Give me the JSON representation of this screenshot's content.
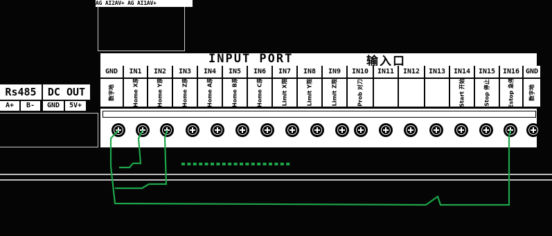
{
  "top_label": "AG AI2AV+ AG AI1AV+",
  "title": {
    "en": "INPUT PORT",
    "cn": "输入口"
  },
  "rs485": {
    "title": "Rs485",
    "a": "A+",
    "b": "B-"
  },
  "dc_out": {
    "title": "DC OUT",
    "gnd": "GND",
    "v5": "5V+"
  },
  "ports": [
    {
      "id": "GND",
      "label": "数字地"
    },
    {
      "id": "IN1",
      "label": "X Home X原点"
    },
    {
      "id": "IN2",
      "label": "Y Home Y原点"
    },
    {
      "id": "IN3",
      "label": "Z Home Z原点"
    },
    {
      "id": "IN4",
      "label": "X Home A原点"
    },
    {
      "id": "IN5",
      "label": "B Home B原点"
    },
    {
      "id": "IN6",
      "label": "C Home C原点"
    },
    {
      "id": "IN7",
      "label": "X Limit X限位"
    },
    {
      "id": "IN8",
      "label": "Y Limit Y限位"
    },
    {
      "id": "IN9",
      "label": "Z Limit Z限位"
    },
    {
      "id": "IN10",
      "label": "Prob 对刀"
    },
    {
      "id": "IN11",
      "label": ""
    },
    {
      "id": "IN12",
      "label": ""
    },
    {
      "id": "IN13",
      "label": ""
    },
    {
      "id": "IN14",
      "label": "Start 开始"
    },
    {
      "id": "IN15",
      "label": "Stop 停止"
    },
    {
      "id": "IN16",
      "label": "Estop 急停"
    },
    {
      "id": "GND",
      "label": "数字地"
    }
  ],
  "colors": {
    "background": "#050505",
    "panel": "#ffffff",
    "wire": "#1ea64a",
    "dots": "#1ea64a"
  }
}
